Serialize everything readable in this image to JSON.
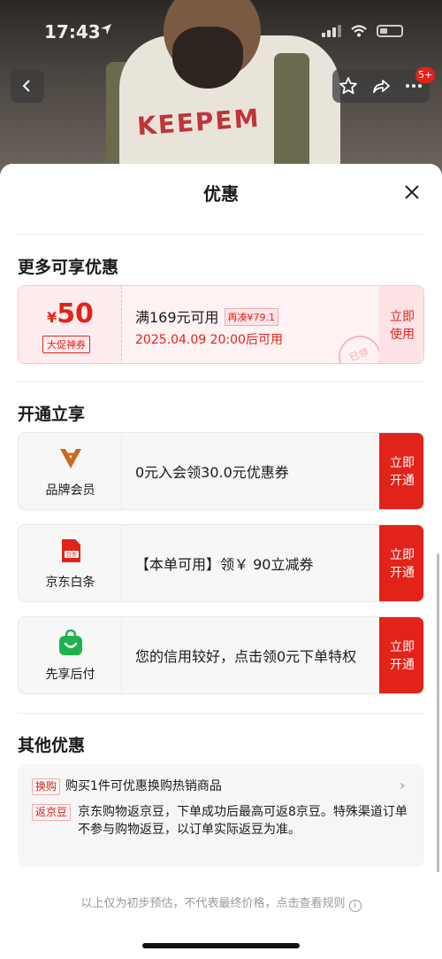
{
  "status": {
    "time": "17:43"
  },
  "nav": {
    "more_badge": "5+",
    "back_icon": "chevron-left-icon",
    "star_icon": "star-icon",
    "share_icon": "share-icon",
    "more_icon": "more-icon"
  },
  "product_print": "KEEPEM",
  "sheet": {
    "title": "优惠"
  },
  "more_discounts": {
    "title": "更多可享优惠",
    "coupon": {
      "currency": "¥",
      "amount": "50",
      "tag": "大促神券",
      "condition": "满169元可用",
      "extra": "再凑¥79.1",
      "valid_time": "2025.04.09 20:00后可用",
      "stamp": "已领",
      "action": "立即使用"
    }
  },
  "open_enjoy": {
    "title": "开通立享",
    "items": [
      {
        "label": "品牌会员",
        "text": "0元入会领30.0元优惠券",
        "action": "立即开通",
        "icon": "brand-member-icon"
      },
      {
        "label": "京东白条",
        "text": "【本单可用】领￥ 90立减券",
        "action": "立即开通",
        "icon": "baitiao-icon"
      },
      {
        "label": "先享后付",
        "text": "您的信用较好，点击领0元下单特权",
        "action": "立即开通",
        "icon": "pay-later-icon"
      }
    ]
  },
  "other": {
    "title": "其他优惠",
    "rows": [
      {
        "tag": "换购",
        "text": "购买1件可优惠换购热销商品"
      },
      {
        "tag": "返京豆",
        "text": "京东购物返京豆，下单成功后最高可返8京豆。特殊渠道订单不参与购物返豆，以订单实际返豆为准。"
      }
    ]
  },
  "footnote": "以上仅为初步预估，不代表最终价格，点击查看规则",
  "colors": {
    "accent": "#e2231a",
    "coupon_bg": "#fff2f3",
    "card_bg": "#f7f7f7"
  }
}
